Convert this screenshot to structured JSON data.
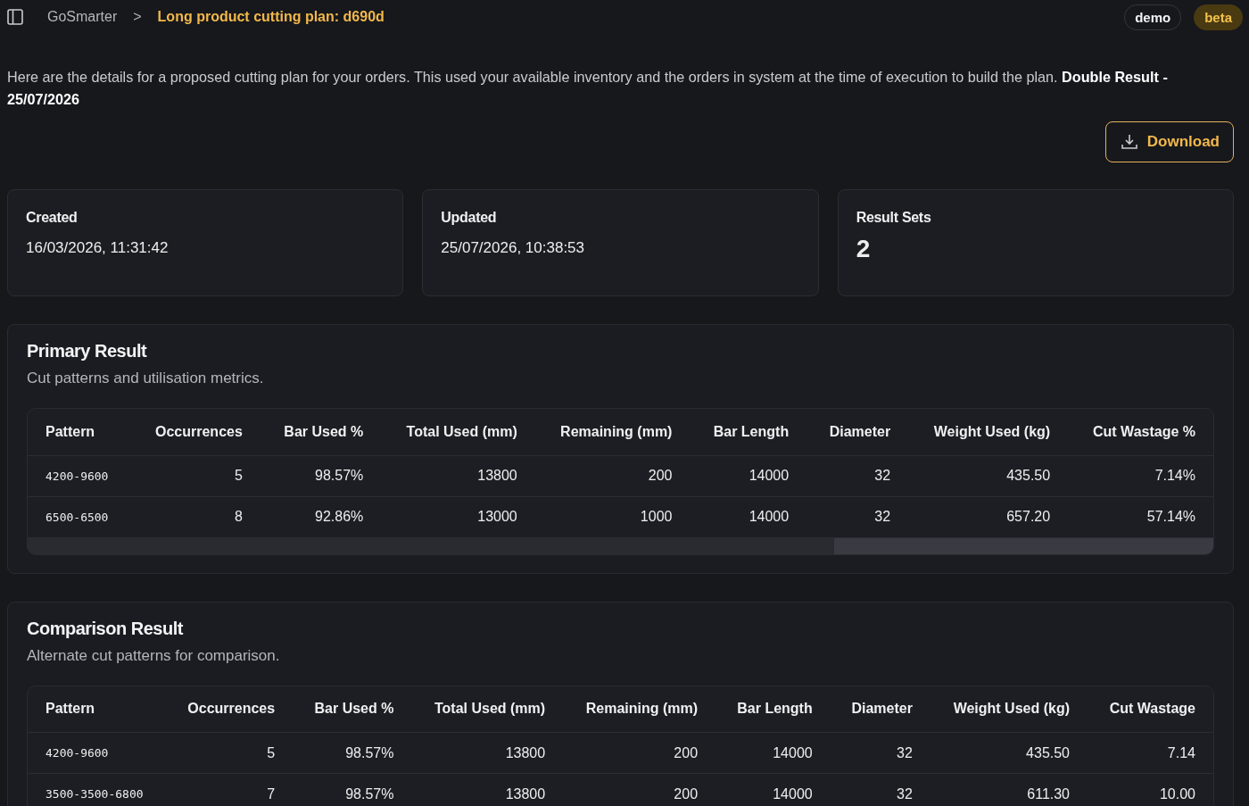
{
  "breadcrumb": {
    "root": "GoSmarter",
    "separator": ">",
    "current": "Long product cutting plan: d690d"
  },
  "badges": [
    {
      "label": "demo",
      "kind": "outline"
    },
    {
      "label": "beta",
      "kind": "accent"
    }
  ],
  "description": "Here are the details for a proposed cutting plan for your orders. This used your available inventory and the orders in system at the time of execution to build the plan. **Double Result - 25/07/2026**",
  "download_button": "Download",
  "stats": [
    {
      "label": "Created",
      "value": "16/03/2026, 11:31:42",
      "kind": "text"
    },
    {
      "label": "Updated",
      "value": "25/07/2026, 10:38:53",
      "kind": "text"
    },
    {
      "label": "Result Sets",
      "value": "2",
      "kind": "number"
    }
  ],
  "results": [
    {
      "title": "Primary Result",
      "subtitle": "Cut patterns and utilisation metrics.",
      "scrollbar": true,
      "columns": [
        "Pattern",
        "Occurrences",
        "Bar Used %",
        "Total Used (mm)",
        "Remaining (mm)",
        "Bar Length",
        "Diameter",
        "Weight Used (kg)",
        "Cut Wastage %"
      ],
      "rows": [
        [
          "4200-9600",
          "5",
          "98.57%",
          "13800",
          "200",
          "14000",
          "32",
          "435.50",
          "7.14%"
        ],
        [
          "6500-6500",
          "8",
          "92.86%",
          "13000",
          "1000",
          "14000",
          "32",
          "657.20",
          "57.14%"
        ]
      ]
    },
    {
      "title": "Comparison Result",
      "subtitle": "Alternate cut patterns for comparison.",
      "columns": [
        "Pattern",
        "Occurrences",
        "Bar Used %",
        "Total Used (mm)",
        "Remaining (mm)",
        "Bar Length",
        "Diameter",
        "Weight Used (kg)",
        "Cut Wastage"
      ],
      "rows": [
        [
          "4200-9600",
          "5",
          "98.57%",
          "13800",
          "200",
          "14000",
          "32",
          "435.50",
          "7.14"
        ],
        [
          "3500-3500-6800",
          "7",
          "98.57%",
          "13800",
          "200",
          "14000",
          "32",
          "611.30",
          "10.00"
        ]
      ]
    }
  ]
}
